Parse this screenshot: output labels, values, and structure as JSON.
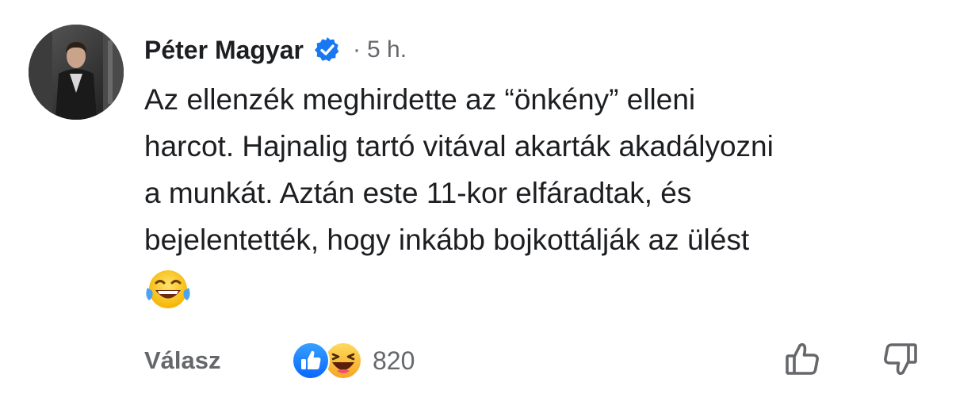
{
  "comment": {
    "author": "Péter Magyar",
    "verified": true,
    "separator": "·",
    "time": "5 h.",
    "text_lines": [
      "Az ellenzék meghirdette az “önkény” elleni",
      "harcot. Hajnalig tartó vitával akarták akadályozni",
      "a munkát. Aztán este 11-kor elfáradtak, és",
      "bejelentették, hogy inkább bojkottálják az ülést"
    ],
    "trailing_emoji": "face-with-tears-of-joy"
  },
  "footer": {
    "reply_label": "Válasz",
    "reactions": [
      "like-icon",
      "haha-icon"
    ],
    "reaction_count": "820",
    "actions": [
      "thumbs-up-icon",
      "thumbs-down-icon"
    ]
  },
  "colors": {
    "text": "#1c1e21",
    "secondary": "#65676b",
    "verified_blue": "#1877f2",
    "like_blue": "#1877f2",
    "haha_yellow": "#f7b125"
  }
}
